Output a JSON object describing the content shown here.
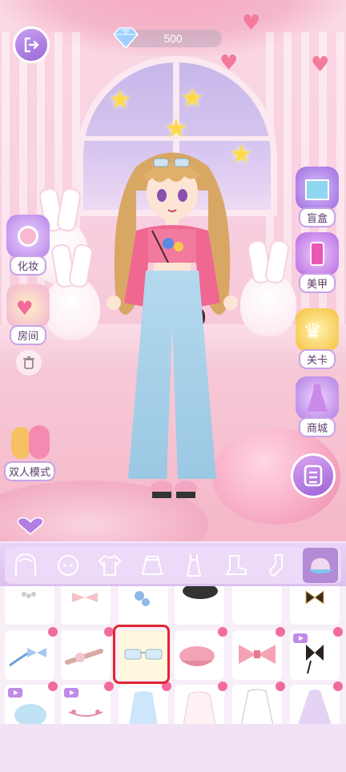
{
  "top": {
    "gems": "500"
  },
  "left_menu": [
    {
      "key": "makeup",
      "label": "化妆"
    },
    {
      "key": "room",
      "label": "房间"
    },
    {
      "key": "double",
      "label": "双人模式"
    }
  ],
  "right_menu": [
    {
      "key": "blind_box",
      "label": "盲盒"
    },
    {
      "key": "nails",
      "label": "美甲"
    },
    {
      "key": "card",
      "label": "关卡"
    },
    {
      "key": "shop",
      "label": "商城"
    }
  ],
  "categories": [
    "hair-icon",
    "face-icon",
    "top-icon",
    "skirt-icon",
    "dress-icon",
    "shoes-icon",
    "socks-icon",
    "hat-icon"
  ],
  "active_category": "hat-icon",
  "colors": {
    "accent": "#b38ad6",
    "badge": "#f26b9a",
    "selection": "#e0262e"
  }
}
